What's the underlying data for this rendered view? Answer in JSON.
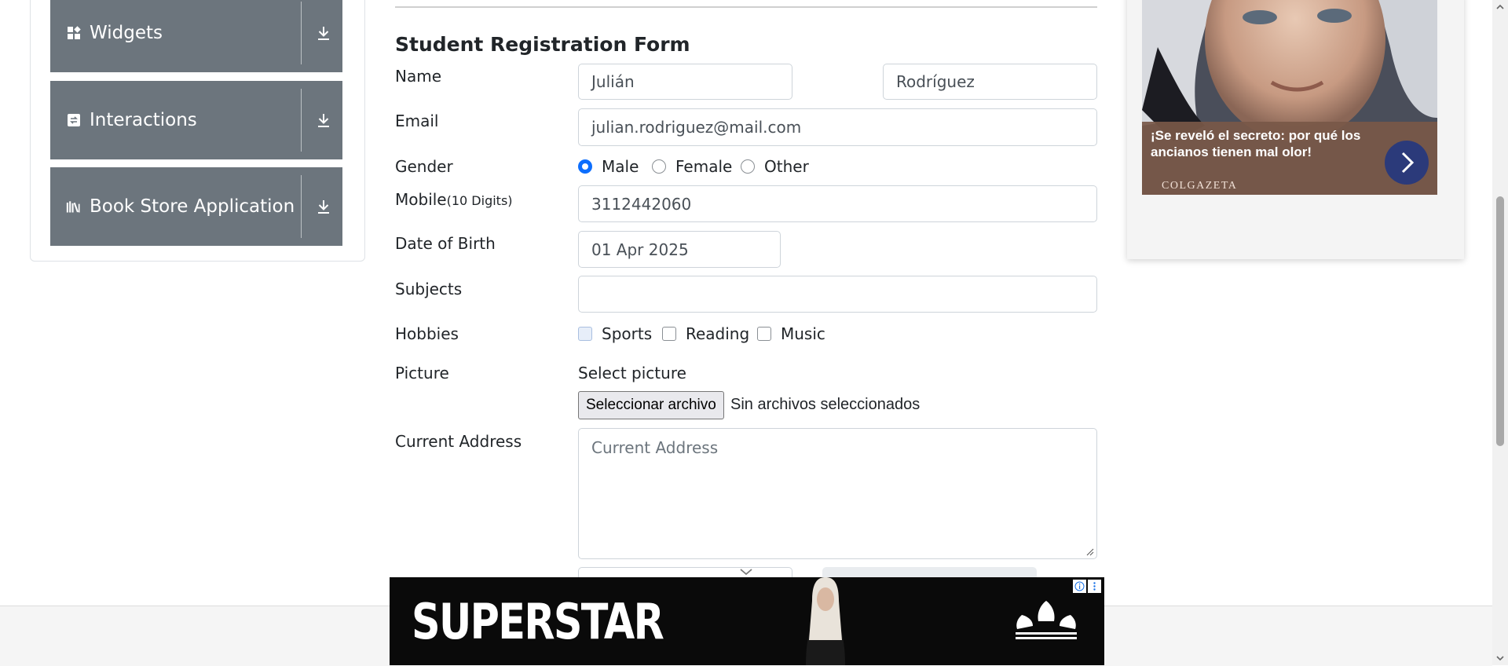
{
  "sidebar": {
    "items": [
      {
        "label": "Widgets",
        "icon": "widgets-icon"
      },
      {
        "label": "Interactions",
        "icon": "interactions-icon"
      },
      {
        "label": "Book Store Application",
        "icon": "book-store-icon"
      }
    ]
  },
  "form": {
    "title": "Student Registration Form",
    "name_label": "Name",
    "first_name": "Julián",
    "last_name": "Rodríguez",
    "email_label": "Email",
    "email": "julian.rodriguez@mail.com",
    "gender_label": "Gender",
    "gender_options": [
      "Male",
      "Female",
      "Other"
    ],
    "gender_selected": "Male",
    "mobile_label": "Mobile",
    "mobile_hint": "(10 Digits)",
    "mobile": "3112442060",
    "dob_label": "Date of Birth",
    "dob": "01 Apr 2025",
    "subjects_label": "Subjects",
    "subjects_value": "",
    "hobbies_label": "Hobbies",
    "hobbies": [
      "Sports",
      "Reading",
      "Music"
    ],
    "picture_label": "Picture",
    "picture_prompt": "Select picture",
    "file_button": "Seleccionar archivo",
    "file_status": "Sin archivos seleccionados",
    "address_label": "Current Address",
    "address_placeholder": "Current Address"
  },
  "side_ad": {
    "headline": "¡Se reveló el secreto: por qué los ancianos tienen mal olor!",
    "brand": "COLGAZETA"
  },
  "bottom_ad": {
    "headline": "SUPERSTAR"
  },
  "colors": {
    "sidebar_item": "#6c757d",
    "accent": "#0d6efd",
    "side_ad_caption": "#785848",
    "side_ad_button": "#2b3a7a",
    "bottom_ad": "#0a0a0a"
  }
}
